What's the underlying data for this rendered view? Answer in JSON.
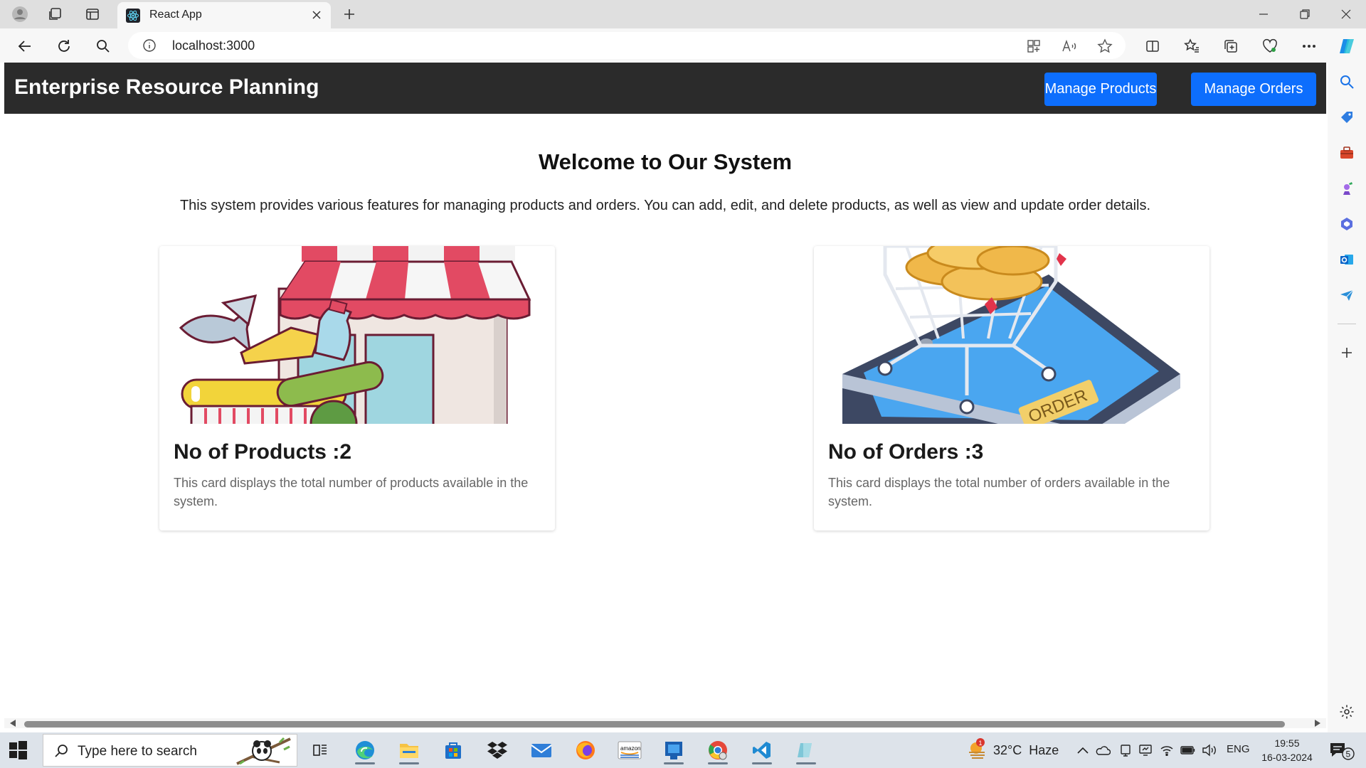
{
  "browser": {
    "tab_title": "React App",
    "url": "localhost:3000"
  },
  "app": {
    "brand": "Enterprise Resource Planning",
    "nav": {
      "manage_products": "Manage Products",
      "manage_orders": "Manage Orders"
    },
    "welcome_title": "Welcome to Our System",
    "welcome_desc": "This system provides various features for managing products and orders. You can add, edit, and delete products, as well as view and update order details.",
    "cards": [
      {
        "title": "No of Products :2",
        "text": "This card displays the total number of products available in the system.",
        "image_icon": "shop-illustration"
      },
      {
        "title": "No of Orders :3",
        "text": "This card displays the total number of orders available in the system.",
        "image_icon": "shopping-cart-illustration",
        "image_label": "ORDER"
      }
    ],
    "accent_color": "#0d6efd",
    "header_color": "#2b2b2b"
  },
  "taskbar": {
    "search_placeholder": "Type here to search",
    "weather": "32°C  Haze",
    "weather_badge": "1",
    "language": "ENG",
    "time": "19:55",
    "date": "16-03-2024",
    "notification_count": "5",
    "amazon_label": "amazon"
  }
}
